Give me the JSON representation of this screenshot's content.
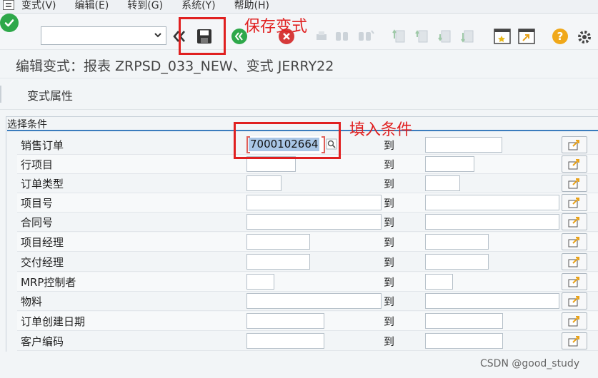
{
  "menu": {
    "items": [
      "变式(V)",
      "编辑(E)",
      "转到(G)",
      "系统(Y)",
      "帮助(H)"
    ]
  },
  "toolbar": {
    "command_value": "",
    "icons": [
      "checkmark-icon",
      "chevron-down-icon",
      "back-icon",
      "save-icon",
      "exit-icon",
      "cancel-icon",
      "print-icon",
      "find-icon",
      "find-next-icon",
      "first-page-icon",
      "previous-page-icon",
      "next-page-icon",
      "last-page-icon",
      "new-session-icon",
      "shortcut-icon",
      "help-icon",
      "settings-icon"
    ]
  },
  "title": "编辑变式：报表 ZRPSD_033_NEW、变式 JERRY22",
  "app_toolbar": {
    "variant_attributes": "变式属性"
  },
  "selection": {
    "group_title": "选择条件",
    "to_label": "到",
    "rows": [
      {
        "label": "销售订单",
        "low": "7000102664",
        "high": ""
      },
      {
        "label": "行项目",
        "low": "",
        "high": ""
      },
      {
        "label": "订单类型",
        "low": "",
        "high": ""
      },
      {
        "label": "项目号",
        "low": "",
        "high": ""
      },
      {
        "label": "合同号",
        "low": "",
        "high": ""
      },
      {
        "label": "项目经理",
        "low": "",
        "high": ""
      },
      {
        "label": "交付经理",
        "low": "",
        "high": ""
      },
      {
        "label": "MRP控制者",
        "low": "",
        "high": ""
      },
      {
        "label": "物料",
        "low": "",
        "high": ""
      },
      {
        "label": "订单创建日期",
        "low": "",
        "high": ""
      },
      {
        "label": "客户编码",
        "low": "",
        "high": ""
      }
    ]
  },
  "annotations": {
    "save": "保存变式",
    "fill": "填入条件",
    "color": "#e02020"
  },
  "watermark": "CSDN @good_study"
}
